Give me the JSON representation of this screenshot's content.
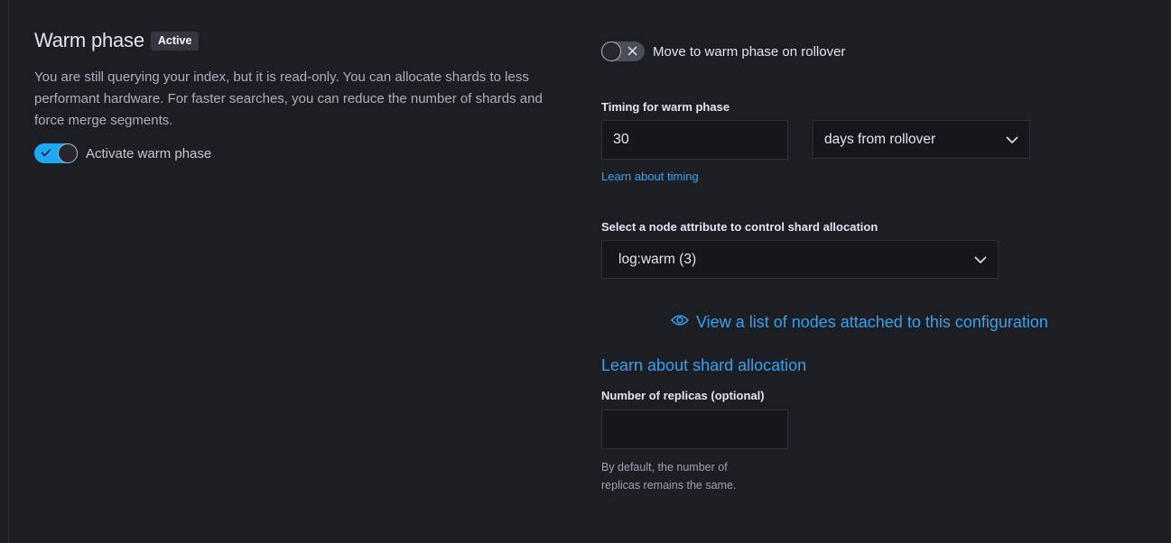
{
  "phase": {
    "title": "Warm phase",
    "badge": "Active",
    "description": "You are still querying your index, but it is read-only. You can allocate shards to less performant hardware. For faster searches, you can reduce the number of shards and force merge segments.",
    "activate_label": "Activate warm phase",
    "activate_on": true
  },
  "rollover": {
    "label": "Move to warm phase on rollover",
    "on": false
  },
  "timing": {
    "label": "Timing for warm phase",
    "value": "30",
    "unit": "days from rollover",
    "learn_link": "Learn about timing"
  },
  "allocation": {
    "label": "Select a node attribute to control shard allocation",
    "selected": "log:warm (3)",
    "view_nodes_link": "View a list of nodes attached to this configuration",
    "learn_link": "Learn about shard allocation"
  },
  "replicas": {
    "label": "Number of replicas (optional)",
    "value": "",
    "help_line1": "By default, the number of",
    "help_line2": "replicas remains the same."
  },
  "colors": {
    "background": "#1d1e24",
    "accent": "#1ba9f5",
    "link": "#36a2ef",
    "input_bg": "#16171c"
  },
  "icons": [
    "check-icon",
    "close-icon",
    "chevron-down-icon",
    "eye-icon"
  ]
}
